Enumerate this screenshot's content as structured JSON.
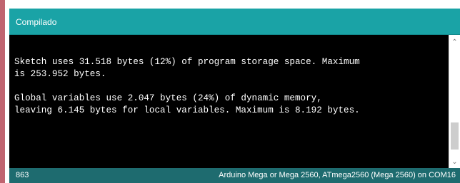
{
  "colors": {
    "accent_strip": "#c06470",
    "status_header": "#1aa3a6",
    "console_background": "#000000",
    "console_text": "#ffffff",
    "footer_background": "#1e6b6f"
  },
  "status": {
    "message": "Compilado"
  },
  "console": {
    "lines": [
      "Sketch uses 31.518 bytes (12%) of program storage space. Maximum",
      "is 253.952 bytes.",
      "",
      "Global variables use 2.047 bytes (24%) of dynamic memory,",
      "leaving 6.145 bytes for local variables. Maximum is 8.192 bytes."
    ]
  },
  "scrollbar": {
    "up_icon": "arrow-up-icon",
    "down_icon": "arrow-down-icon"
  },
  "footer": {
    "line_number": "863",
    "board_info": "Arduino Mega or Mega 2560, ATmega2560 (Mega 2560) on COM16"
  }
}
